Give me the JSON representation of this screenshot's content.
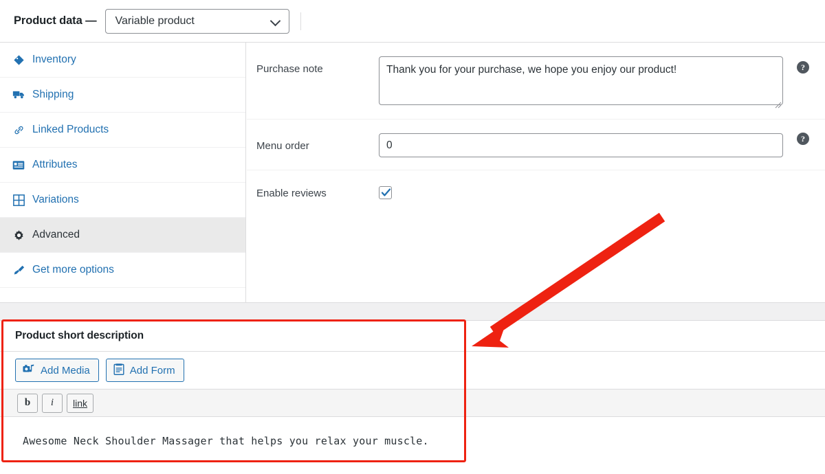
{
  "product_data": {
    "title": "Product data —",
    "type_select": {
      "value": "Variable product",
      "chevron_icon": "chevron-down-icon"
    },
    "tabs": [
      {
        "label": "Inventory",
        "icon": "tag-icon",
        "active": false
      },
      {
        "label": "Shipping",
        "icon": "truck-icon",
        "active": false
      },
      {
        "label": "Linked Products",
        "icon": "link-icon",
        "active": false
      },
      {
        "label": "Attributes",
        "icon": "list-card-icon",
        "active": false
      },
      {
        "label": "Variations",
        "icon": "grid-icon",
        "active": false
      },
      {
        "label": "Advanced",
        "icon": "gear-icon",
        "active": true
      },
      {
        "label": "Get more options",
        "icon": "plugin-icon",
        "active": false
      }
    ],
    "fields": {
      "purchase_note": {
        "label": "Purchase note",
        "value": "Thank you for your purchase, we hope you enjoy our product!",
        "placeholder": "",
        "help_icon": "help-icon"
      },
      "menu_order": {
        "label": "Menu order",
        "value": "0",
        "placeholder": "",
        "help_icon": "help-icon"
      },
      "enable_reviews": {
        "label": "Enable reviews",
        "checked": true
      }
    }
  },
  "short_description": {
    "title": "Product short description",
    "media_buttons": [
      {
        "label": "Add Media",
        "icon": "media-icon"
      },
      {
        "label": "Add Form",
        "icon": "form-icon"
      }
    ],
    "format_toolbar": [
      {
        "label": "b",
        "icon": "bold-icon"
      },
      {
        "label": "i",
        "icon": "italic-icon"
      },
      {
        "label": "link",
        "icon": "link-icon"
      }
    ],
    "editor_text": "Awesome Neck Shoulder Massager that helps you relax your muscle."
  },
  "annotations": {
    "highlight_color": "#ee2211",
    "arrow": {
      "color": "#ee2211",
      "from": "965,315",
      "to": "690,500"
    }
  },
  "colors": {
    "link_blue": "#2271b1",
    "text_dark": "#1d2327",
    "panel_border": "#dcdcde",
    "active_tab_bg": "#eaeaea",
    "toolbar_bg": "#f5f5f5",
    "accent_red": "#ee2211"
  }
}
